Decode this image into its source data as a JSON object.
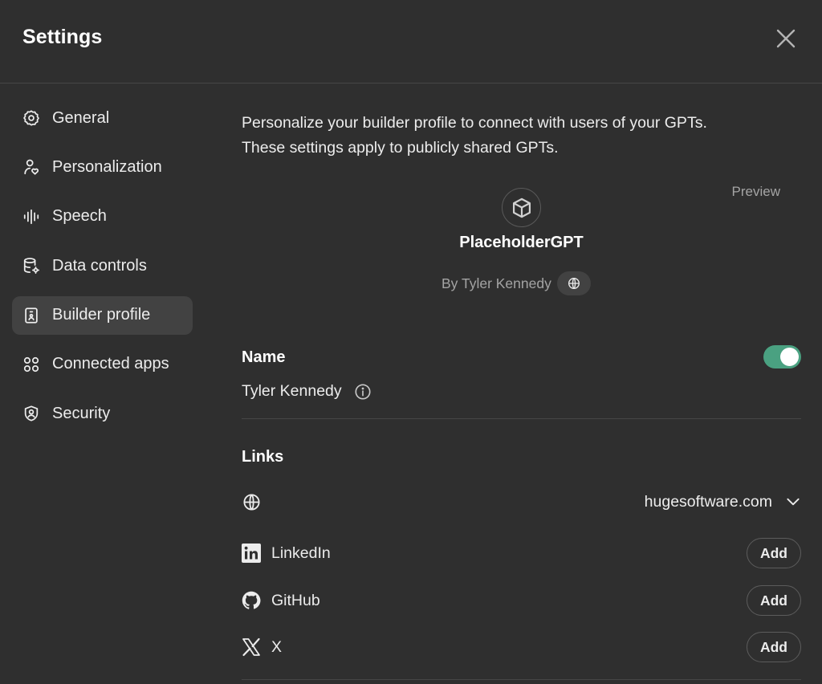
{
  "dialog": {
    "title": "Settings",
    "close_icon": "close-icon"
  },
  "sidebar": {
    "items": [
      {
        "label": "General",
        "icon": "gear-icon",
        "active": false
      },
      {
        "label": "Personalization",
        "icon": "person-heart-icon",
        "active": false
      },
      {
        "label": "Speech",
        "icon": "waveform-icon",
        "active": false
      },
      {
        "label": "Data controls",
        "icon": "database-gear-icon",
        "active": false
      },
      {
        "label": "Builder profile",
        "icon": "id-badge-icon",
        "active": true
      },
      {
        "label": "Connected apps",
        "icon": "apps-grid-icon",
        "active": false
      },
      {
        "label": "Security",
        "icon": "shield-user-icon",
        "active": false
      }
    ]
  },
  "builder_profile": {
    "intro_line1": "Personalize your builder profile to connect with users of your GPTs.",
    "intro_line2": "These settings apply to publicly shared GPTs.",
    "preview_label": "Preview",
    "preview": {
      "gpt_icon": "cube-icon",
      "gpt_name": "PlaceholderGPT",
      "byline": "By Tyler Kennedy",
      "byline_link_icon": "globe-icon"
    },
    "name_section": {
      "label": "Name",
      "value": "Tyler Kennedy",
      "info_icon": "info-icon",
      "toggle_on": true,
      "toggle_color": "#4aa181"
    },
    "links_section": {
      "label": "Links",
      "website": {
        "icon": "globe-icon",
        "value": "hugesoftware.com",
        "dropdown_icon": "chevron-down-icon"
      },
      "items": [
        {
          "label": "LinkedIn",
          "icon": "linkedin-icon",
          "button": "Add"
        },
        {
          "label": "GitHub",
          "icon": "github-icon",
          "button": "Add"
        },
        {
          "label": "X",
          "icon": "x-logo-icon",
          "button": "Add"
        }
      ]
    }
  }
}
